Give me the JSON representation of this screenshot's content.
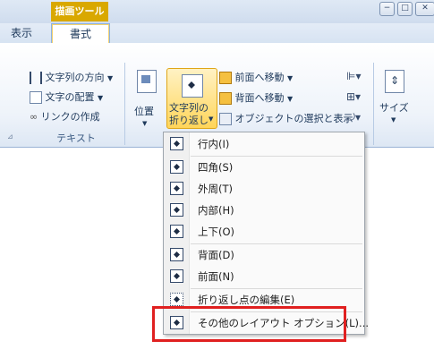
{
  "titlebar": {
    "tools_label": "描画ツール",
    "min": "−",
    "restore": "□"
  },
  "tabs": [
    {
      "label": "表示"
    },
    {
      "label": "書式"
    }
  ],
  "ribbon": {
    "text_group": {
      "direction": "文字列の方向",
      "align": "文字の配置",
      "link": "リンクの作成",
      "label": "テキスト"
    },
    "position_label": "位置",
    "wrap_label_1": "文字列の",
    "wrap_label_2": "折り返し",
    "arrange": {
      "front": "前面へ移動",
      "back": "背面へ移動",
      "select": "オブジェクトの選択と表示"
    },
    "size_label": "サイズ"
  },
  "wrap_menu": {
    "items": [
      {
        "label": "行内(I)"
      },
      {
        "label": "四角(S)"
      },
      {
        "label": "外周(T)"
      },
      {
        "label": "内部(H)"
      },
      {
        "label": "上下(O)"
      },
      {
        "label": "背面(D)"
      },
      {
        "label": "前面(N)"
      },
      {
        "label": "折り返し点の編集(E)"
      },
      {
        "label": "その他のレイアウト オプション(L)..."
      }
    ]
  }
}
